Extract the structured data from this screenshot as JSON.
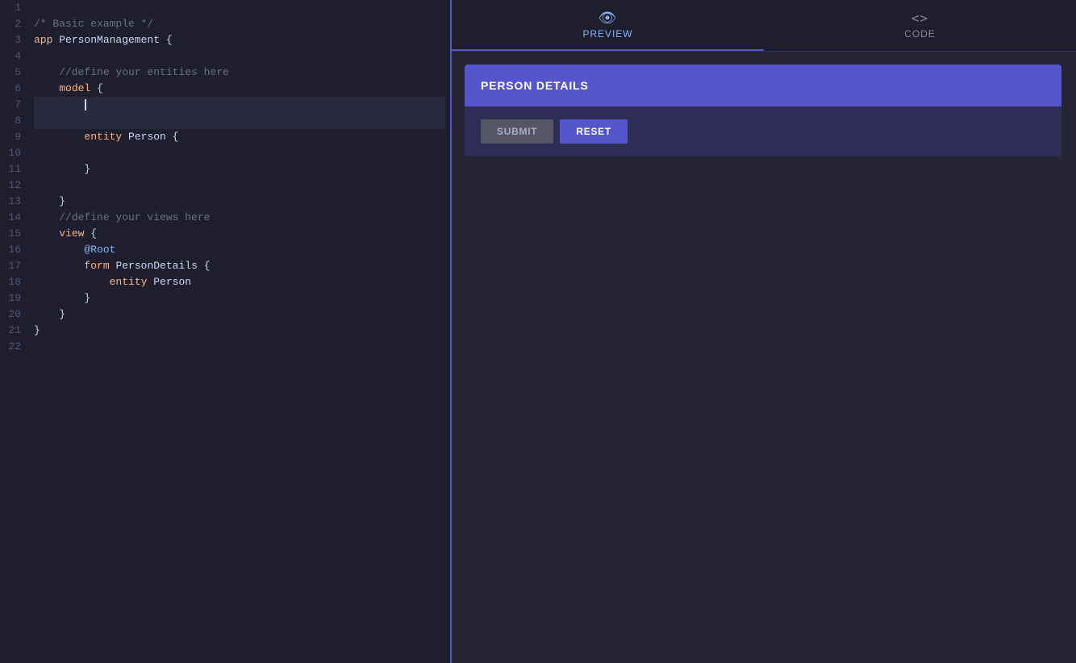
{
  "editor": {
    "lines": [
      {
        "num": 1,
        "text": "",
        "tokens": []
      },
      {
        "num": 2,
        "raw": "/* Basic example */",
        "type": "comment"
      },
      {
        "num": 3,
        "raw": "app PersonManagement {",
        "type": "mixed"
      },
      {
        "num": 4,
        "text": "",
        "tokens": []
      },
      {
        "num": 5,
        "raw": "    //define your entities here",
        "type": "comment"
      },
      {
        "num": 6,
        "raw": "    model {",
        "type": "mixed"
      },
      {
        "num": 7,
        "raw": "        |",
        "type": "cursor",
        "highlighted": true
      },
      {
        "num": 8,
        "raw": "        |",
        "type": "cursor-only",
        "highlighted": true
      },
      {
        "num": 9,
        "raw": "        entity Person {",
        "type": "mixed"
      },
      {
        "num": 10,
        "text": ""
      },
      {
        "num": 11,
        "raw": "        }",
        "type": "plain"
      },
      {
        "num": 12,
        "text": ""
      },
      {
        "num": 13,
        "raw": "    }",
        "type": "plain"
      },
      {
        "num": 14,
        "raw": "    //define your views here",
        "type": "comment"
      },
      {
        "num": 15,
        "raw": "    view {",
        "type": "mixed"
      },
      {
        "num": 16,
        "raw": "        @Root",
        "type": "plain"
      },
      {
        "num": 17,
        "raw": "        form PersonDetails {",
        "type": "mixed"
      },
      {
        "num": 18,
        "raw": "            entity Person",
        "type": "mixed"
      },
      {
        "num": 19,
        "raw": "        }",
        "type": "plain"
      },
      {
        "num": 20,
        "raw": "    }",
        "type": "plain"
      },
      {
        "num": 21,
        "raw": "}",
        "type": "plain"
      },
      {
        "num": 22,
        "text": ""
      }
    ]
  },
  "tabs": {
    "preview": {
      "label": "PREVIEW",
      "icon": "👁"
    },
    "code": {
      "label": "CODE",
      "icon": "<>"
    }
  },
  "preview": {
    "form_title": "PERSON DETAILS",
    "submit_label": "SUBMIT",
    "reset_label": "RESET"
  }
}
